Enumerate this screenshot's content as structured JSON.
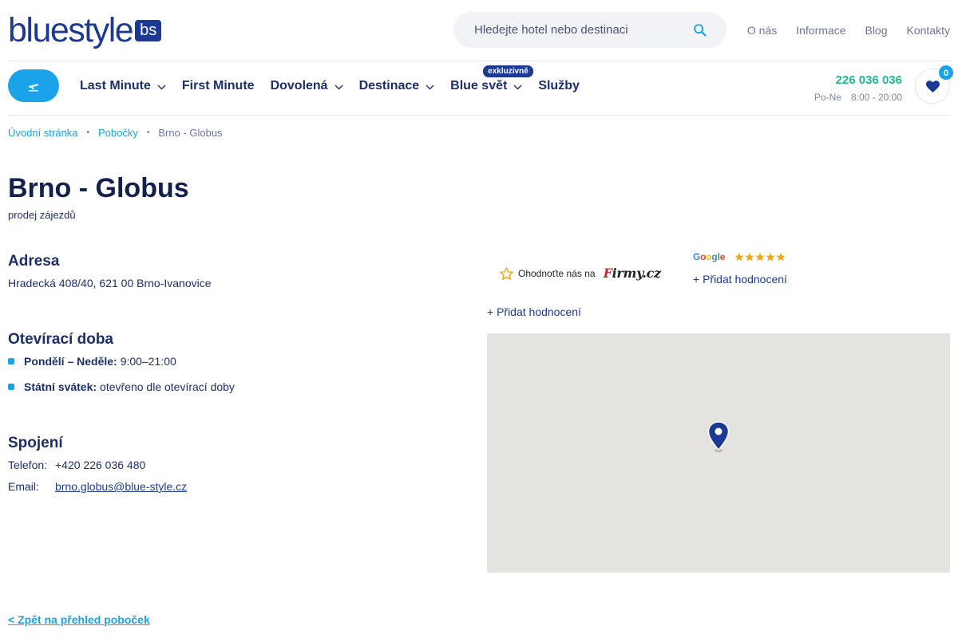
{
  "header": {
    "logo_text": "bluestyle",
    "logo_badge": "bs",
    "search_placeholder": "Hledejte hotel nebo destinaci",
    "top_links": [
      "O nás",
      "Informace",
      "Blog",
      "Kontakty"
    ]
  },
  "nav": {
    "items": [
      {
        "label": "Last Minute",
        "dropdown": true
      },
      {
        "label": "First Minute",
        "dropdown": false
      },
      {
        "label": "Dovolená",
        "dropdown": true
      },
      {
        "label": "Destinace",
        "dropdown": true
      },
      {
        "label": "Blue svět",
        "dropdown": true,
        "badge": "exkluzivně"
      },
      {
        "label": "Služby",
        "dropdown": false
      }
    ],
    "phone": "226 036 036",
    "hours_days": "Po-Ne",
    "hours_time": "8:00 - 20:00",
    "favorites_count": "0"
  },
  "breadcrumb": {
    "home": "Úvodní stránka",
    "branches": "Pobočky",
    "current": "Brno - Globus"
  },
  "page": {
    "title": "Brno - Globus",
    "subtitle": "prodej zájezdů"
  },
  "address": {
    "heading": "Adresa",
    "text": "Hradecká 408/40, 621 00 Brno-Ivanovice"
  },
  "opening": {
    "heading": "Otevírací doba",
    "rows": [
      {
        "label": "Pondělí – Neděle:",
        "value": "9:00–21:00"
      },
      {
        "label": "Státní svátek:",
        "value": "otevřeno dle otevírací doby"
      }
    ]
  },
  "contact": {
    "heading": "Spojení",
    "phone_label": "Telefon:",
    "phone_value": "+420 226 036 480",
    "email_label": "Email:",
    "email_value": "brno.globus@blue-style.cz"
  },
  "ratings": {
    "firmy_text": "Ohodnoťte nás na",
    "firmy_logo": "Firmy.cz",
    "google_stars": 5,
    "add_rating_google": "+ Přidat hodnocení",
    "add_rating": "+ Přidat hodnocení"
  },
  "footer": {
    "back_link": "< Zpět na přehled poboček"
  },
  "colors": {
    "brand_blue": "#1c3a93",
    "accent_cyan": "#1aa3e8",
    "phone_green": "#1cbb8e",
    "star_orange": "#f3a712"
  }
}
